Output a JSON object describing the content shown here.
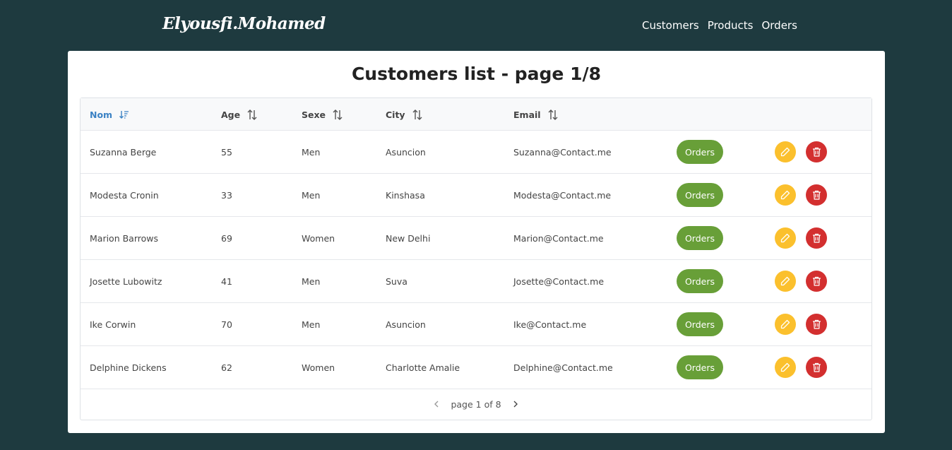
{
  "nav": {
    "brand": "Elyousfi.Mohamed",
    "links": [
      "Customers",
      "Products",
      "Orders"
    ]
  },
  "page": {
    "title": "Customers list - page 1/8"
  },
  "table": {
    "columns": [
      "Nom",
      "Age",
      "Sexe",
      "City",
      "Email"
    ],
    "sorted_column": "Nom",
    "orders_label": "Orders",
    "rows": [
      {
        "name": "Suzanna Berge",
        "age": "55",
        "sexe": "Men",
        "city": "Asuncion",
        "email": "Suzanna@Contact.me"
      },
      {
        "name": "Modesta Cronin",
        "age": "33",
        "sexe": "Men",
        "city": "Kinshasa",
        "email": "Modesta@Contact.me"
      },
      {
        "name": "Marion Barrows",
        "age": "69",
        "sexe": "Women",
        "city": "New Delhi",
        "email": "Marion@Contact.me"
      },
      {
        "name": "Josette Lubowitz",
        "age": "41",
        "sexe": "Men",
        "city": "Suva",
        "email": "Josette@Contact.me"
      },
      {
        "name": "Ike Corwin",
        "age": "70",
        "sexe": "Men",
        "city": "Asuncion",
        "email": "Ike@Contact.me"
      },
      {
        "name": "Delphine Dickens",
        "age": "62",
        "sexe": "Women",
        "city": "Charlotte Amalie",
        "email": "Delphine@Contact.me"
      }
    ]
  },
  "paginator": {
    "text": "page 1 of 8"
  },
  "colors": {
    "background": "#1e3a3f",
    "orders_button": "#689f38",
    "edit_button": "#fbc02d",
    "delete_button": "#d32f2f",
    "active_sort": "#3b82c4"
  },
  "icons": {
    "sort_active": "sort-amount-down-icon",
    "sort_inactive": "sort-alt-icon",
    "edit": "pencil-icon",
    "delete": "trash-icon",
    "prev": "chevron-left-icon",
    "next": "chevron-right-icon"
  }
}
